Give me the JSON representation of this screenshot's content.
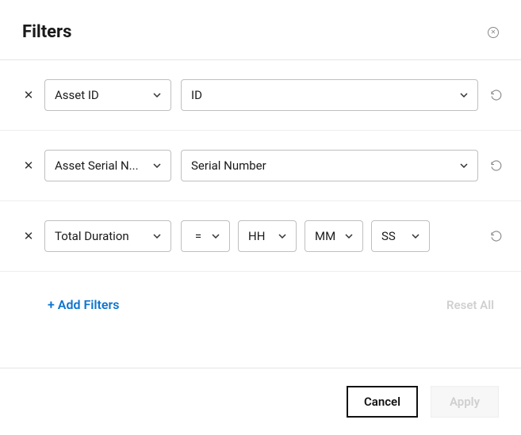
{
  "header": {
    "title": "Filters"
  },
  "filters": [
    {
      "field": "Asset ID",
      "value": "ID"
    },
    {
      "field": "Asset Serial N...",
      "value": "Serial Number"
    },
    {
      "field": "Total Duration",
      "op": "=",
      "hh": "HH",
      "mm": "MM",
      "ss": "SS"
    }
  ],
  "actions": {
    "add_filters": "+ Add Filters",
    "reset_all": "Reset All"
  },
  "footer": {
    "cancel": "Cancel",
    "apply": "Apply"
  }
}
